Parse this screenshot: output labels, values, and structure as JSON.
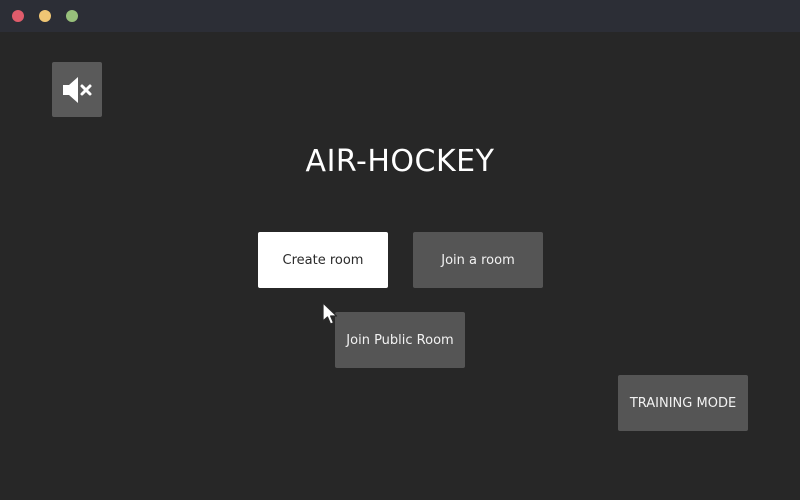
{
  "window": {
    "controls": [
      "close",
      "minimize",
      "maximize"
    ]
  },
  "toolbar": {
    "mute_icon": "speaker-muted-icon"
  },
  "main": {
    "title": "AIR-HOCKEY",
    "create_room_label": "Create room",
    "join_room_label": "Join a room",
    "join_public_label": "Join Public Room",
    "training_mode_label": "TRAINING MODE"
  },
  "colors": {
    "background": "#272727",
    "titlebar": "#2c2e36",
    "button_dark": "#555555",
    "button_light": "#ffffff",
    "close": "#e05c6b",
    "minimize": "#f0c674",
    "maximize": "#98c07b"
  }
}
